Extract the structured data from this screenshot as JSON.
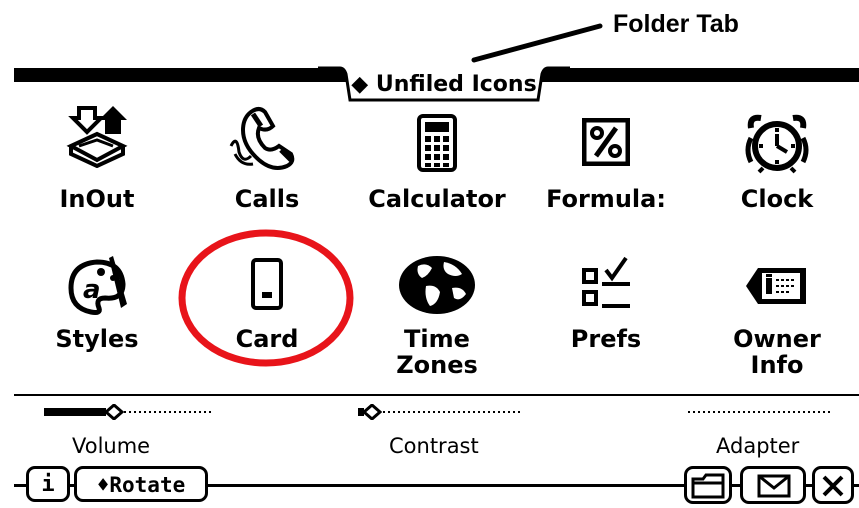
{
  "annotation": {
    "label": "Folder Tab"
  },
  "folder": {
    "title": "◆ Unfiled Icons"
  },
  "apps": [
    {
      "id": "inout",
      "label": "InOut",
      "icon": "inout-icon"
    },
    {
      "id": "calls",
      "label": "Calls",
      "icon": "phone-icon"
    },
    {
      "id": "calculator",
      "label": "Calculator",
      "icon": "calculator-icon"
    },
    {
      "id": "formulas",
      "label": "Formula:",
      "icon": "percent-icon"
    },
    {
      "id": "clock",
      "label": "Clock",
      "icon": "alarm-clock-icon"
    },
    {
      "id": "styles",
      "label": "Styles",
      "icon": "palette-icon"
    },
    {
      "id": "card",
      "label": "Card",
      "icon": "pc-card-icon"
    },
    {
      "id": "timezones",
      "label": "Time Zones",
      "label_line1": "Time",
      "label_line2": "Zones",
      "icon": "globe-icon"
    },
    {
      "id": "prefs",
      "label": "Prefs",
      "icon": "checklist-icon"
    },
    {
      "id": "ownerinfo",
      "label": "Owner Info",
      "label_line1": "Owner",
      "label_line2": "Info",
      "icon": "id-tag-icon"
    }
  ],
  "highlighted_app": "card",
  "controls": {
    "volume": {
      "label": "Volume",
      "level": 0.4
    },
    "contrast": {
      "label": "Contrast",
      "level": 0.05
    },
    "adapter": {
      "label": "Adapter"
    }
  },
  "bottom": {
    "info_label": "i",
    "rotate_label": "♦Rotate",
    "folder_icon": "folder-icon",
    "mail_icon": "envelope-icon",
    "close_icon": "close-icon"
  },
  "colors": {
    "highlight": "#e8141a",
    "ink": "#000000",
    "paper": "#ffffff"
  }
}
